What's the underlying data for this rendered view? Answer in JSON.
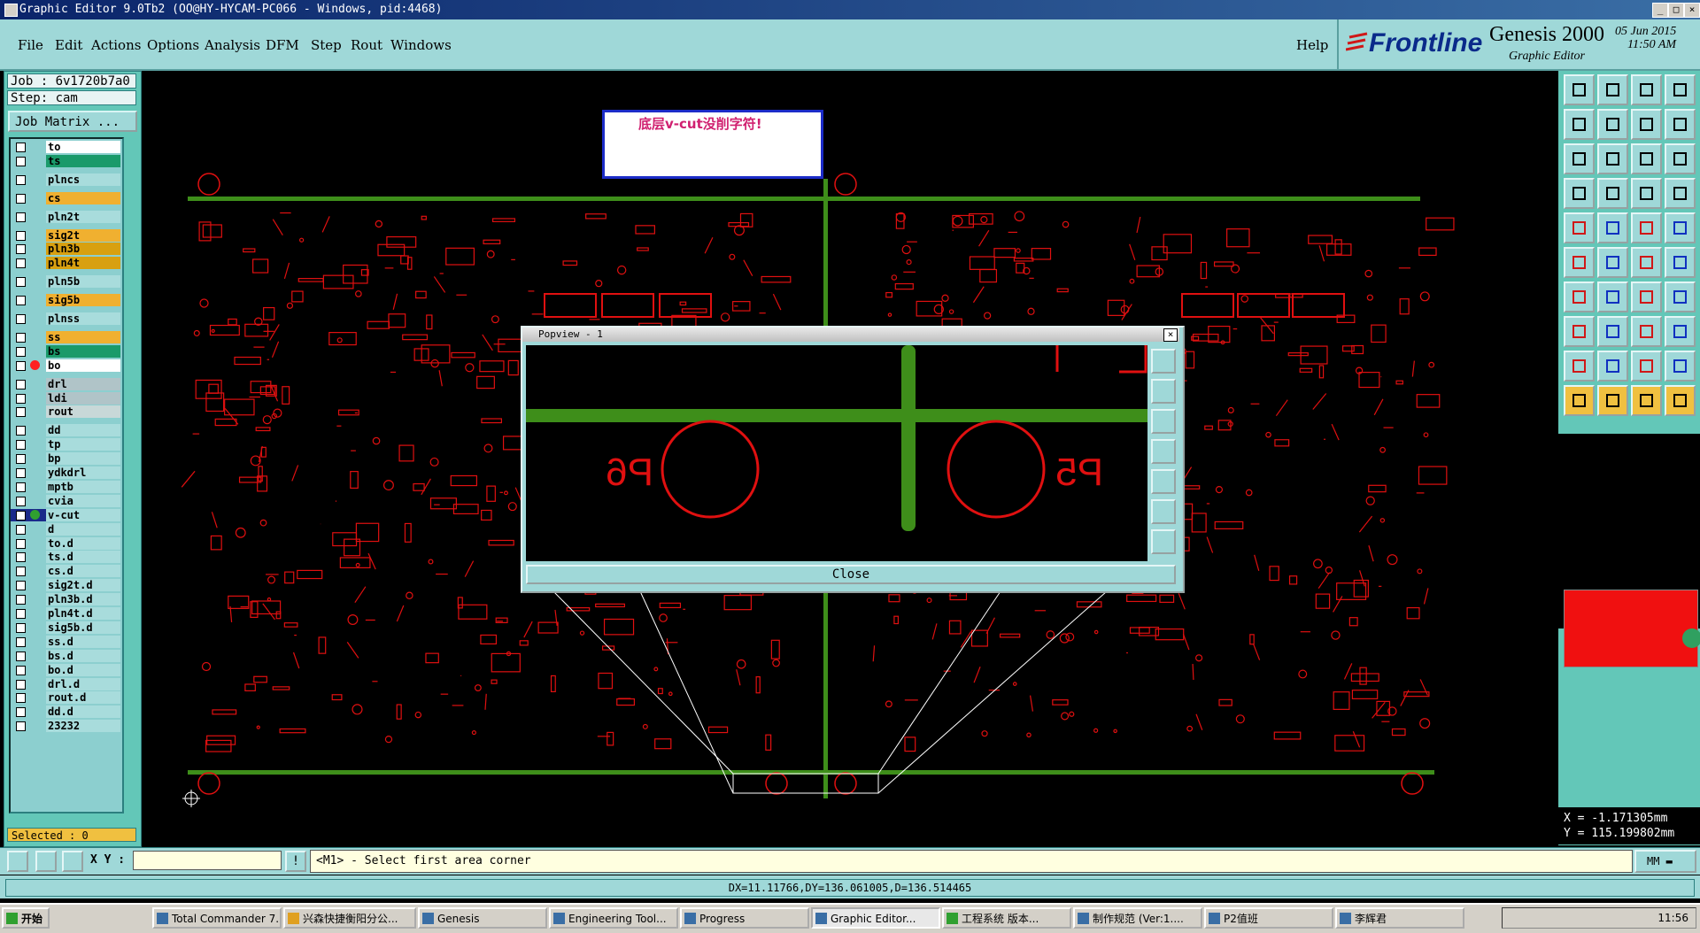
{
  "window": {
    "title": "Graphic Editor 9.0Tb2 (OO@HY-HYCAM-PC066 - Windows, pid:4468)"
  },
  "menu": {
    "items": [
      "File",
      "Edit",
      "Actions",
      "Options",
      "Analysis",
      "DFM",
      "Step",
      "Rout",
      "Windows"
    ],
    "help": "Help"
  },
  "brand": {
    "logo": "Frontline",
    "product": "Genesis 2000",
    "subtitle": "Graphic Editor",
    "date": "05 Jun 2015",
    "time": "11:50 AM"
  },
  "job": {
    "name": "Job : 6v1720b7a0",
    "step": "Step: cam",
    "matrix_button": "Job Matrix ..."
  },
  "layers": [
    {
      "name": "to",
      "color": "#ffffff"
    },
    {
      "name": "ts",
      "color": "#1a9a6a"
    },
    {
      "name": "plncs",
      "color": "#a8dcdc"
    },
    {
      "name": "cs",
      "color": "#f0b030"
    },
    {
      "name": "pln2t",
      "color": "#a8dcdc"
    },
    {
      "name": "sig2t",
      "color": "#f0b030"
    },
    {
      "name": "pln3b",
      "color": "#d8a010"
    },
    {
      "name": "pln4t",
      "color": "#d8a010"
    },
    {
      "name": "pln5b",
      "color": "#a8dcdc"
    },
    {
      "name": "sig5b",
      "color": "#f0b030"
    },
    {
      "name": "plnss",
      "color": "#a8dcdc"
    },
    {
      "name": "ss",
      "color": "#f0b030"
    },
    {
      "name": "bs",
      "color": "#1a9a6a"
    },
    {
      "name": "bo",
      "color": "#ffffff",
      "dot": "#ff2020"
    },
    {
      "name": "drl",
      "color": "#b0c4c8"
    },
    {
      "name": "ldi",
      "color": "#b0c4c8"
    },
    {
      "name": "rout",
      "color": "#c8d8d8"
    },
    {
      "name": "dd",
      "color": "#a8dcdc"
    },
    {
      "name": "tp",
      "color": "#a8dcdc"
    },
    {
      "name": "bp",
      "color": "#a8dcdc"
    },
    {
      "name": "ydkdrl",
      "color": "#a8dcdc"
    },
    {
      "name": "mptb",
      "color": "#a8dcdc"
    },
    {
      "name": "cvia",
      "color": "#a8dcdc"
    },
    {
      "name": "v-cut",
      "color": "#a8dcdc",
      "dot": "#30a030",
      "active": true
    },
    {
      "name": "d",
      "color": "#a8dcdc"
    },
    {
      "name": "to.d",
      "color": "#a8dcdc"
    },
    {
      "name": "ts.d",
      "color": "#a8dcdc"
    },
    {
      "name": "cs.d",
      "color": "#a8dcdc"
    },
    {
      "name": "sig2t.d",
      "color": "#a8dcdc"
    },
    {
      "name": "pln3b.d",
      "color": "#a8dcdc"
    },
    {
      "name": "pln4t.d",
      "color": "#a8dcdc"
    },
    {
      "name": "sig5b.d",
      "color": "#a8dcdc"
    },
    {
      "name": "ss.d",
      "color": "#a8dcdc"
    },
    {
      "name": "bs.d",
      "color": "#a8dcdc"
    },
    {
      "name": "bo.d",
      "color": "#a8dcdc"
    },
    {
      "name": "drl.d",
      "color": "#a8dcdc"
    },
    {
      "name": "rout.d",
      "color": "#a8dcdc"
    },
    {
      "name": "dd.d",
      "color": "#a8dcdc"
    },
    {
      "name": "23232",
      "color": "#a8dcdc"
    }
  ],
  "selected": "Selected : 0",
  "alert": {
    "text": "底层v-cut没削字符!"
  },
  "popview": {
    "title": "Popview - 1",
    "close_label": "Close",
    "left_label": "P6",
    "right_label": "P5"
  },
  "canvas": {
    "pad_labels": [
      "P6",
      "P5",
      "P6",
      "P5",
      "P6",
      "P5"
    ]
  },
  "coords": {
    "x": "X = -1.171305mm",
    "y": "Y = 115.199802mm"
  },
  "command": {
    "xy_label": "X Y :",
    "xy_value": "",
    "prompt": "<M1> - Select first area corner",
    "unit": "MM"
  },
  "status": {
    "measure": "DX=11.11766,DY=136.061005,D=136.514465"
  },
  "taskbar": {
    "start": "开始",
    "tasks": [
      "Total Commander 7...",
      "兴森快捷衡阳分公...",
      "Genesis",
      "Engineering Tool...",
      "Progress",
      "Graphic Editor...",
      "工程系统     版本...",
      "制作规范 (Ver:1....",
      "P2值班",
      "李辉君"
    ],
    "clock": "11:56"
  },
  "colors": {
    "panel": "#9fd8d8",
    "accent": "#63c7b8",
    "copper": "#e01010",
    "vcut": "#3e8e1a"
  }
}
